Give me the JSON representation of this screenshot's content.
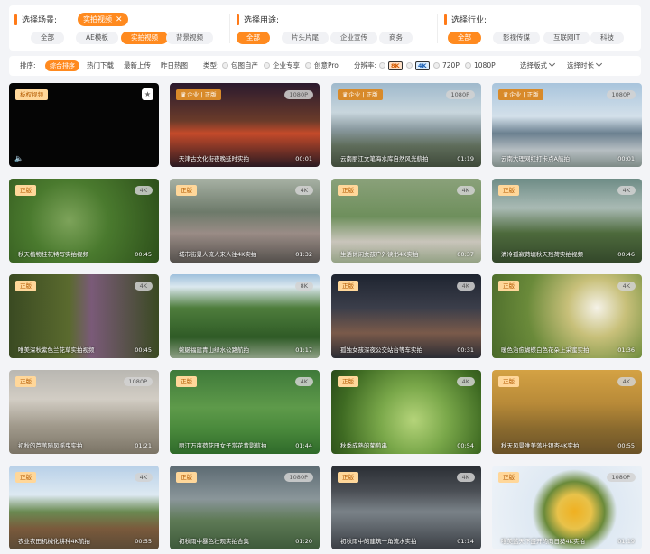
{
  "filters": {
    "scene": {
      "title": "选择场景:",
      "selected_tag": "实拍视频",
      "options": [
        "全部",
        "AE模板",
        "实拍视频",
        "背景视频"
      ],
      "active": 2
    },
    "usage": {
      "title": "选择用途:",
      "options": [
        "全部",
        "片头片尾",
        "企业宣传",
        "商务"
      ],
      "active": 0
    },
    "industry": {
      "title": "选择行业:",
      "options": [
        "全部",
        "影视传媒",
        "互联网IT",
        "科技"
      ],
      "active": 0
    }
  },
  "sortbar": {
    "sort_label": "排序:",
    "sort_options": [
      "综合排序",
      "热门下载",
      "最新上传",
      "昨日热图"
    ],
    "type_label": "类型:",
    "type_options": [
      "包图自产",
      "企业专享",
      "创意Pro"
    ],
    "res_label": "分辨率:",
    "res_options": [
      "8K",
      "4K",
      "720P",
      "1080P"
    ],
    "format_label": "选择版式",
    "duration_label": "选择时长"
  },
  "cards": [
    {
      "title": "",
      "dur": "",
      "tag": "板权视频",
      "res": "",
      "style": "video"
    },
    {
      "title": "天津古文化街夜晚延时实拍",
      "dur": "00:01",
      "tag": "企业 | 正版",
      "res": "1080P",
      "crown": true
    },
    {
      "title": "云南丽江文笔海水库自然风光航拍",
      "dur": "01:19",
      "tag": "企业 | 正版",
      "res": "1080P",
      "crown": true
    },
    {
      "title": "云南大理网红打卡点A航拍",
      "dur": "00:01",
      "tag": "企业 | 正版",
      "res": "1080P",
      "crown": true
    },
    {
      "title": "秋天植物桂花特写实拍视频",
      "dur": "00:45",
      "tag": "正版",
      "res": "4K"
    },
    {
      "title": "城市街景人流人来人往4K实拍",
      "dur": "01:32",
      "tag": "正版",
      "res": "4K"
    },
    {
      "title": "生活休闲女孩户外读书4K实拍",
      "dur": "00:37",
      "tag": "正版",
      "res": "4K"
    },
    {
      "title": "清冷孤寂荷塘秋天残荷实拍视频",
      "dur": "00:46",
      "tag": "正版",
      "res": "4K"
    },
    {
      "title": "唯美深秋紫色兰花草实拍视频",
      "dur": "00:45",
      "tag": "正版",
      "res": "4K"
    },
    {
      "title": "蜿蜒福建青山绿水公路航拍",
      "dur": "01:17",
      "tag": "",
      "res": "8K"
    },
    {
      "title": "孤独女孩深夜公交站台等车实拍",
      "dur": "00:31",
      "tag": "正版",
      "res": "4K"
    },
    {
      "title": "暖色治愈蝴蝶白色花朵上采蜜实拍",
      "dur": "01:36",
      "tag": "正版",
      "res": "4K"
    },
    {
      "title": "初秋的芦苇随风摇曳实拍",
      "dur": "01:21",
      "tag": "正版",
      "res": "1080P"
    },
    {
      "title": "丽江万亩荷花田女子赏花背影航拍",
      "dur": "01:44",
      "tag": "正版",
      "res": "4K"
    },
    {
      "title": "秋季成熟的葡萄串",
      "dur": "00:54",
      "tag": "正版",
      "res": "4K"
    },
    {
      "title": "秋天风景唯美落叶银杏4K实拍",
      "dur": "00:55",
      "tag": "正版",
      "res": "4K"
    },
    {
      "title": "农业农田机械化耕种4K航拍",
      "dur": "00:55",
      "tag": "正版",
      "res": "4K"
    },
    {
      "title": "初秋雨中暴色壮观实拍合集",
      "dur": "01:20",
      "tag": "正版",
      "res": "1080P"
    },
    {
      "title": "初秋雨中的建筑一角流水实拍",
      "dur": "01:14",
      "tag": "正版",
      "res": "4K"
    },
    {
      "title": "唯美蓝天下盛开的向日葵4K实拍",
      "dur": "01:19",
      "tag": "正版",
      "res": "1080P"
    }
  ]
}
